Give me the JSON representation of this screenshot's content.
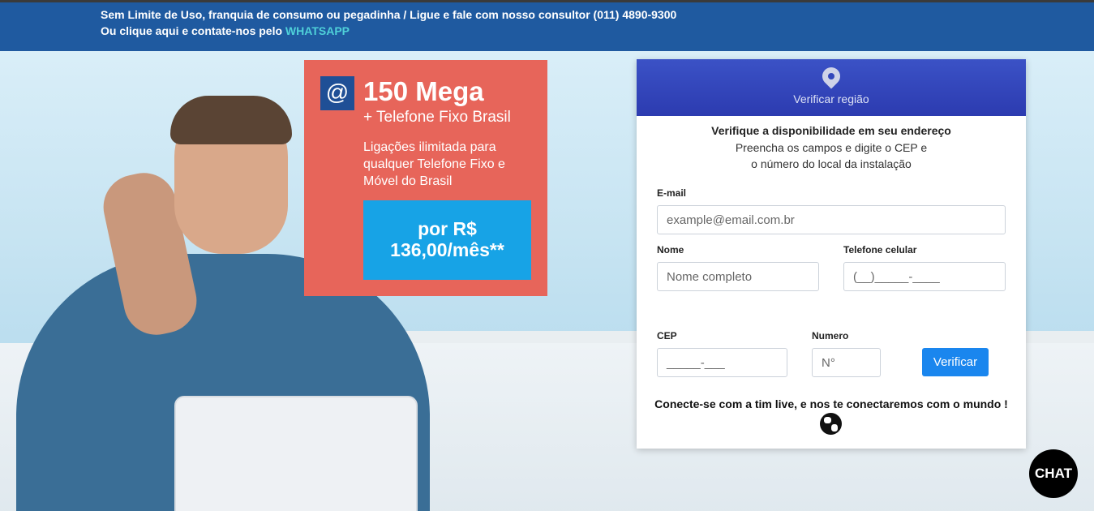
{
  "topbar": {
    "line1": "Sem Limite de Uso, franquia de consumo ou pegadinha / Ligue e fale com nosso consultor (011) 4890-9300",
    "line2_prefix": "Ou clique aqui e contate-nos pelo ",
    "line2_link": "WHATSAPP"
  },
  "promo": {
    "icon": "@",
    "speed": "150 Mega",
    "subtitle": "+ Telefone Fixo Brasil",
    "description": "Ligações ilimitada para qualquer Telefone Fixo e Móvel do Brasil",
    "price_line1": "por R$",
    "price_line2": "136,00/mês**"
  },
  "form": {
    "header_icon": "location-pin-icon",
    "header_title": "Verificar região",
    "heading": "Verifique a disponibilidade em seu endereço",
    "subheading1": "Preencha os campos e digite o CEP e",
    "subheading2": "o número do local da instalação",
    "email_label": "E-mail",
    "email_placeholder": "example@email.com.br",
    "name_label": "Nome",
    "name_placeholder": "Nome completo",
    "phone_label": "Telefone celular",
    "phone_placeholder": "(__)_____-____",
    "cep_label": "CEP",
    "cep_placeholder": "_____-___",
    "number_label": "Numero",
    "number_placeholder": "N°",
    "submit_label": "Verificar",
    "footer": "Conecte-se com a tim live, e nos te conectaremos com o mundo !"
  },
  "chat": {
    "label": "CHAT"
  },
  "colors": {
    "topbar": "#1f5aa0",
    "promo": "#e7655a",
    "price": "#17a3e6",
    "form_header": "#2c3bb0",
    "button": "#1a86ee"
  }
}
